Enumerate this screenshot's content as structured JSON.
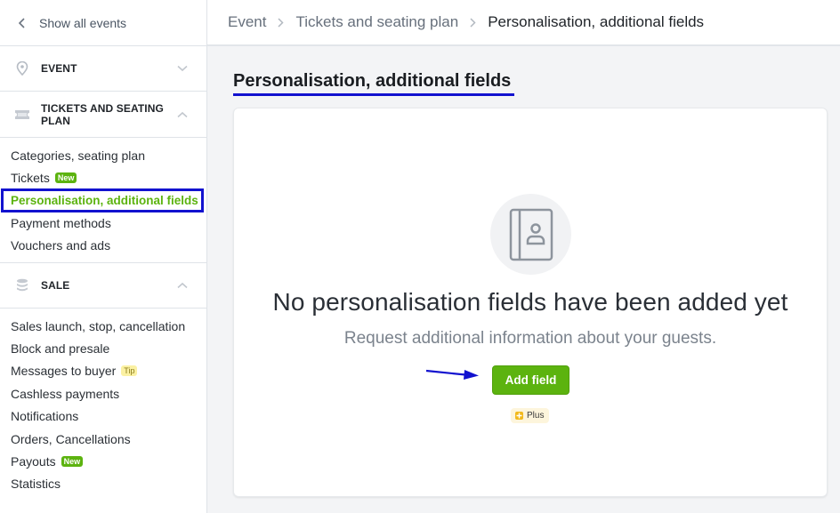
{
  "sidebar": {
    "back_label": "Show all events",
    "sections": [
      {
        "title": "EVENT",
        "icon": "location-pin-icon",
        "expanded": false
      },
      {
        "title": "TICKETS AND SEATING PLAN",
        "title_line1": "TICKETS AND SEATING",
        "title_line2": "PLAN",
        "icon": "ticket-icon",
        "expanded": true,
        "items": [
          {
            "label": "Categories, seating plan"
          },
          {
            "label": "Tickets",
            "badge": "New"
          },
          {
            "label": "Personalisation, additional fields",
            "active": true
          },
          {
            "label": "Payment methods"
          },
          {
            "label": "Vouchers and ads"
          }
        ]
      },
      {
        "title": "SALE",
        "icon": "database-stack-icon",
        "expanded": true,
        "items": [
          {
            "label": "Sales launch, stop, cancellation"
          },
          {
            "label": "Block and presale"
          },
          {
            "label": "Messages to buyer",
            "badge": "Tip"
          },
          {
            "label": "Cashless payments"
          },
          {
            "label": "Notifications"
          },
          {
            "label": "Orders, Cancellations"
          },
          {
            "label": "Payouts",
            "badge": "New"
          },
          {
            "label": "Statistics"
          }
        ]
      }
    ]
  },
  "breadcrumb": [
    "Event",
    "Tickets and seating plan",
    "Personalisation, additional fields"
  ],
  "page": {
    "title": "Personalisation, additional fields"
  },
  "empty_state": {
    "icon": "contact-book-icon",
    "title": "No personalisation fields have been added yet",
    "subtitle": "Request additional information about your guests.",
    "button_label": "Add field",
    "plan_badge": "Plus"
  },
  "colors": {
    "accent_green": "#5cb30f",
    "annotation_blue": "#1212cf",
    "tip_yellow": "#fbf1a3",
    "plus_badge_bg": "#fdf5dc"
  }
}
